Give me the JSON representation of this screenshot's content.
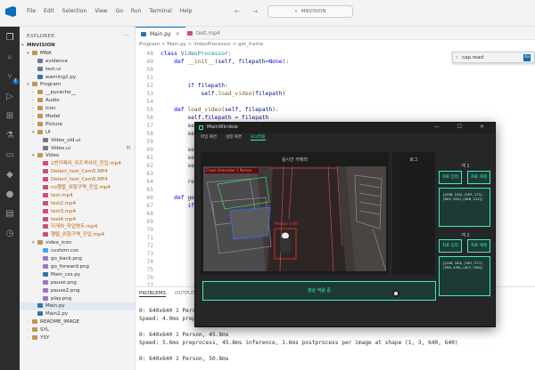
{
  "titlebar": {
    "menu": [
      "File",
      "Edit",
      "Selection",
      "View",
      "Go",
      "Run",
      "Terminal",
      "Help"
    ],
    "nav": "← →",
    "search": "MNVISION"
  },
  "sidebar": {
    "header": "EXPLORER",
    "root": "MNVISION",
    "items": [
      {
        "label": "MNA",
        "type": "folder",
        "depth": 1,
        "open": true
      },
      {
        "label": "evidence",
        "type": "file",
        "depth": 2
      },
      {
        "label": "test.ui",
        "type": "file",
        "depth": 2
      },
      {
        "label": "warning2.py",
        "type": "py",
        "depth": 2
      },
      {
        "label": "Program",
        "type": "folder",
        "depth": 1,
        "open": true
      },
      {
        "label": "__pycache__",
        "type": "folder",
        "depth": 2
      },
      {
        "label": "Audio",
        "type": "folder",
        "depth": 2
      },
      {
        "label": "Icon",
        "type": "folder",
        "depth": 2
      },
      {
        "label": "Model",
        "type": "folder",
        "depth": 2
      },
      {
        "label": "Picture",
        "type": "folder",
        "depth": 2
      },
      {
        "label": "UI",
        "type": "folder",
        "depth": 2,
        "open": true
      },
      {
        "label": "Video_old.ui",
        "type": "file",
        "depth": 3
      },
      {
        "label": "Video.ui",
        "type": "file",
        "depth": 3,
        "badge": "M"
      },
      {
        "label": "Video",
        "type": "folder",
        "depth": 2,
        "open": true
      },
      {
        "label": "1번카메라_무즈색사이_진입.mp4",
        "type": "mp4",
        "depth": 3
      },
      {
        "label": "Detect_test_Cam5.MP4",
        "type": "mp4",
        "depth": 3
      },
      {
        "label": "Detect_test_Cam6.MP4",
        "type": "mp4",
        "depth": 3
      },
      {
        "label": "no행렬_위험구역_진입.mp4",
        "type": "mp4",
        "depth": 3
      },
      {
        "label": "test.mp4",
        "type": "mp4",
        "depth": 3
      },
      {
        "label": "test2.mp4",
        "type": "mp4",
        "depth": 3
      },
      {
        "label": "test3.mp4",
        "type": "mp4",
        "depth": 3
      },
      {
        "label": "test4.mp4",
        "type": "mp4",
        "depth": 3
      },
      {
        "label": "지게차_작업영두.mp4",
        "type": "mp4",
        "depth": 3
      },
      {
        "label": "행렬_위험구역_진입.mp4",
        "type": "mp4",
        "depth": 3
      },
      {
        "label": "video_icon",
        "type": "folder",
        "depth": 2,
        "open": true
      },
      {
        "label": "custom.css",
        "type": "css",
        "depth": 3
      },
      {
        "label": "go_back.png",
        "type": "png",
        "depth": 3
      },
      {
        "label": "go_forward.png",
        "type": "png",
        "depth": 3
      },
      {
        "label": "Main_css.py",
        "type": "py",
        "depth": 3
      },
      {
        "label": "pause.png",
        "type": "png",
        "depth": 3
      },
      {
        "label": "pause2.png",
        "type": "png",
        "depth": 3
      },
      {
        "label": "play.png",
        "type": "png",
        "depth": 3
      },
      {
        "label": "Main.py",
        "type": "py",
        "depth": 2,
        "selected": true
      },
      {
        "label": "Main2.py",
        "type": "py",
        "depth": 2
      },
      {
        "label": "README_IMAGE",
        "type": "folder",
        "depth": 1
      },
      {
        "label": "SYL",
        "type": "folder",
        "depth": 1
      },
      {
        "label": "YSY",
        "type": "folder",
        "depth": 1
      }
    ]
  },
  "editor": {
    "tabs": [
      {
        "label": "Main.py",
        "kind": "py",
        "active": true
      },
      {
        "label": "test.mp4",
        "kind": "mp4",
        "active": false
      }
    ],
    "breadcrumb": "Program > Main.py > VideoProcessor > get_frame",
    "find": {
      "query": "cap.read",
      "case_toggle": "Aa"
    },
    "lines": [
      {
        "n": "48",
        "text": "class VideoProcessor:"
      },
      {
        "n": "49",
        "text": "    def __init__(self, filepath=None):"
      },
      {
        "n": "50",
        "text": ""
      },
      {
        "n": "51",
        "text": ""
      },
      {
        "n": "52",
        "text": "        if filepath:"
      },
      {
        "n": "53",
        "text": "            self.load_video(filepath)"
      },
      {
        "n": "54",
        "text": ""
      },
      {
        "n": "55",
        "text": "    def load_video(self, filepath):"
      },
      {
        "n": "56",
        "text": "        self.filepath = filepath"
      },
      {
        "n": "57",
        "text": "        se"
      },
      {
        "n": "58",
        "text": "        se"
      },
      {
        "n": "59",
        "text": ""
      },
      {
        "n": "60",
        "text": "        se"
      },
      {
        "n": "61",
        "text": "        se"
      },
      {
        "n": "62",
        "text": "        se"
      },
      {
        "n": "63",
        "text": ""
      },
      {
        "n": "64",
        "text": "        re"
      },
      {
        "n": "65",
        "text": ""
      },
      {
        "n": "66",
        "text": "    def ge"
      },
      {
        "n": "67",
        "text": "        if"
      },
      {
        "n": "68",
        "text": ""
      },
      {
        "n": "69",
        "text": ""
      },
      {
        "n": "70",
        "text": ""
      },
      {
        "n": "71",
        "text": ""
      },
      {
        "n": "72",
        "text": ""
      },
      {
        "n": "73",
        "text": ""
      },
      {
        "n": "74",
        "text": ""
      },
      {
        "n": "75",
        "text": ""
      },
      {
        "n": "76",
        "text": ""
      },
      {
        "n": "77",
        "text": ""
      },
      {
        "n": "78",
        "text": "    def se"
      }
    ]
  },
  "panel": {
    "tabs": [
      "PROBLEMS",
      "OUTPUT"
    ],
    "terminal": [
      "0: 640x640 1 Person,",
      "Speed: 4.0ms prepro",
      "",
      "0: 640x640 1 Person, 45.8ms",
      "Speed: 5.6ms preprocess, 45.8ms inference, 1.6ms postprocess per image at shape (1, 3, 640, 640)",
      "",
      "0: 640x640 1 Person, 50.8ms"
    ]
  },
  "mainwindow": {
    "title": "MainWindow",
    "controls": "— ☐ ✕",
    "menu": [
      {
        "label": "파일 화면",
        "selected": false
      },
      {
        "label": "설정 화면",
        "selected": false
      },
      {
        "label": "모니터링",
        "selected": true
      }
    ],
    "camera_label": "실시간 카메라",
    "log_label": "로그",
    "detection_label": "Person  0.87",
    "top_banner": "Crane Detection 1 Person",
    "track1": {
      "label": "객 1",
      "btn_a": "좌표 입력",
      "btn_b": "좌표 해제",
      "coords": "[(296, 150), (187, 171), (605, 320), (498, 211)]"
    },
    "track2": {
      "label": "객 2",
      "btn_a": "좌표 입력",
      "btn_b": "좌표 해제",
      "coords": "[(146, 184), (387, 577), (356, 436), (407, 256)]"
    },
    "bottom_button": "영상 적용 중"
  }
}
